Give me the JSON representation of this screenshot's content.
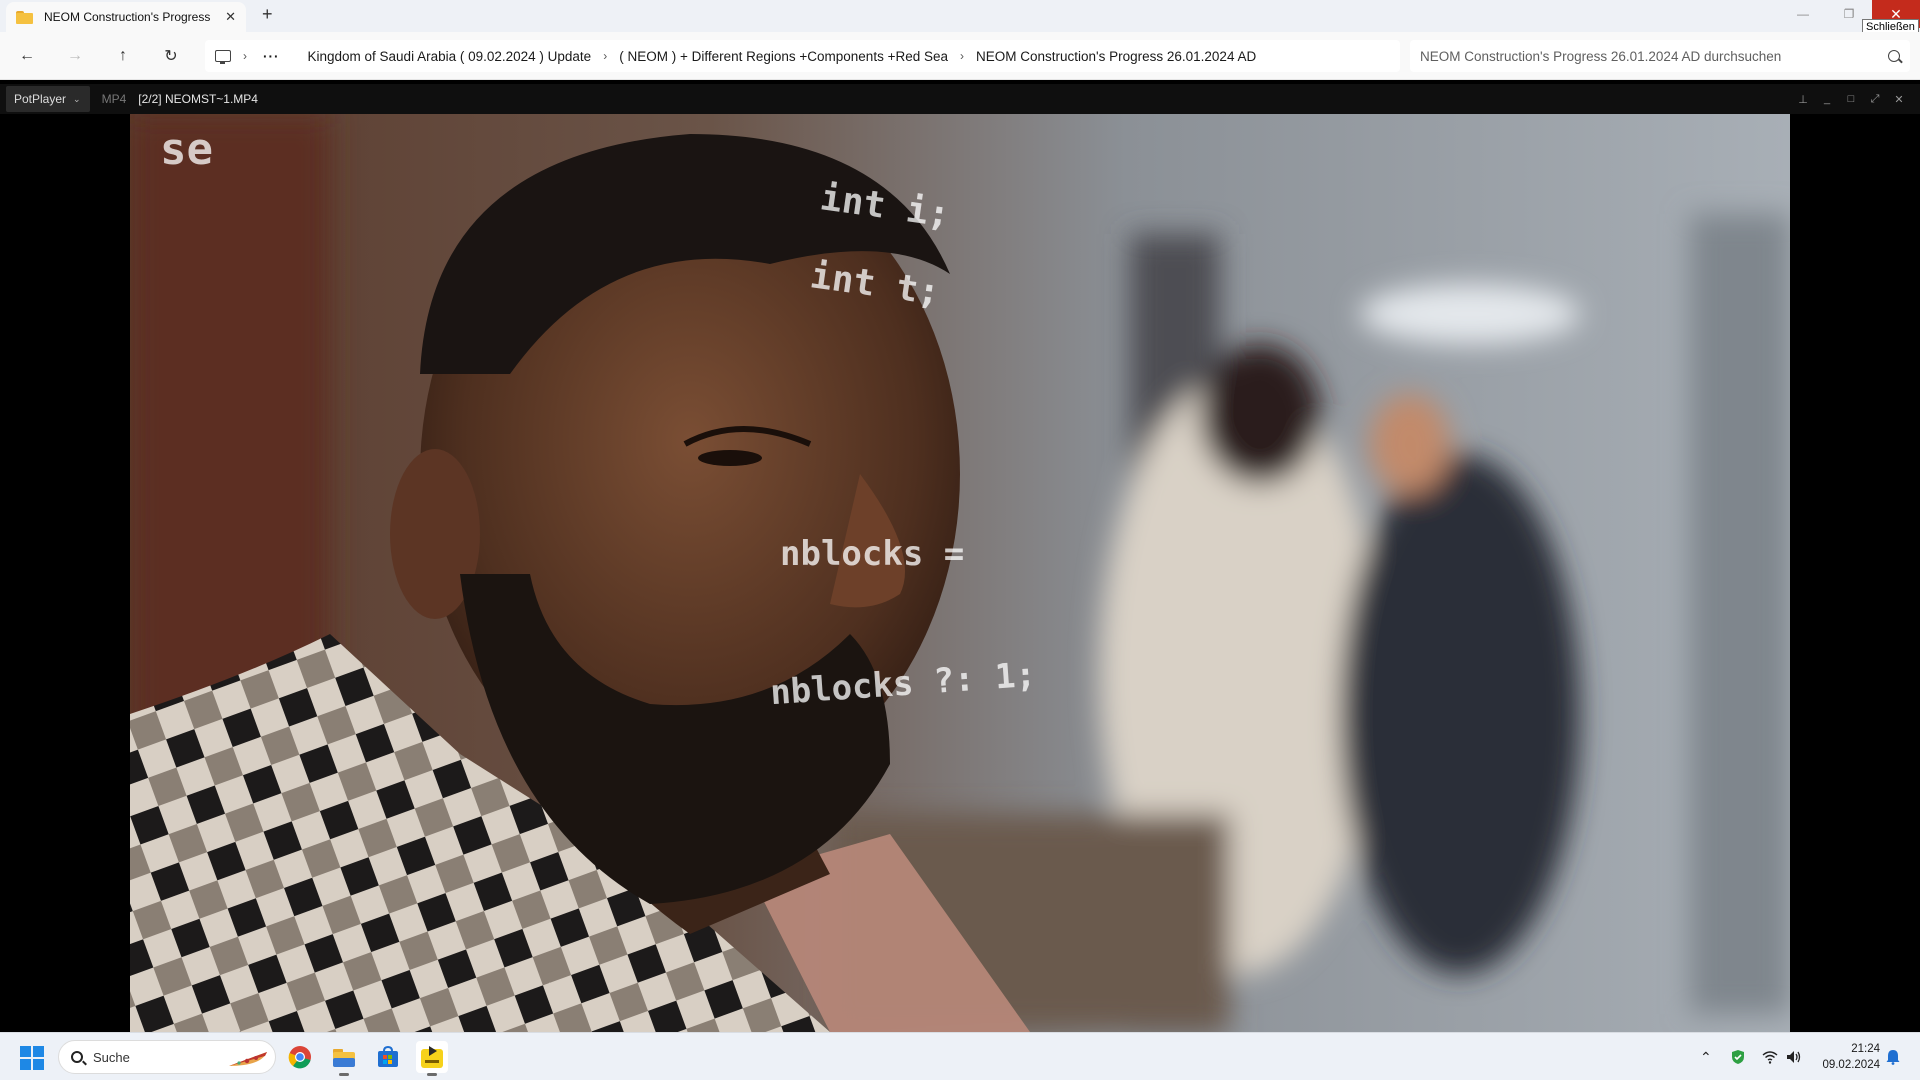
{
  "explorer": {
    "tab_title": "NEOM Construction's Progress",
    "tab_close": "✕",
    "new_tab": "+",
    "window_controls": {
      "minimize": "—",
      "maximize": "❐",
      "close": "✕"
    },
    "close_tooltip": "Schließen",
    "nav": {
      "back": "←",
      "forward": "→",
      "up": "↑",
      "refresh": "↻"
    },
    "breadcrumbs": [
      "Kingdom of Saudi Arabia ( 09.02.2024 ) Update",
      "( NEOM ) + Different Regions +Components +Red Sea",
      "NEOM Construction's Progress 26.01.2024 AD"
    ],
    "breadcrumb_more": "···",
    "search_placeholder": "NEOM Construction's Progress 26.01.2024 AD durchsuchen"
  },
  "player": {
    "menu_label": "PotPlayer",
    "format": "MP4",
    "file_title": "[2/2] NEOMST~1.MP4",
    "controls": {
      "pin": "⊥",
      "minimize": "_",
      "maximize": "□",
      "fullscreen": "⤢",
      "close": "✕"
    },
    "video_overlay_text": [
      "se",
      "int i;",
      "int t;",
      "nblocks = ",
      "nblocks ?: 1;"
    ]
  },
  "taskbar": {
    "search_label": "Suche",
    "apps": [
      "chrome-icon",
      "file-explorer-icon",
      "microsoft-store-icon",
      "potplayer-icon"
    ],
    "time": "21:24",
    "date": "09.02.2024"
  },
  "colors": {
    "close_red": "#c42b1c",
    "taskbar_bg": "#edf1f7",
    "player_bg": "#000000",
    "folder_yellow": "#f5c140"
  }
}
